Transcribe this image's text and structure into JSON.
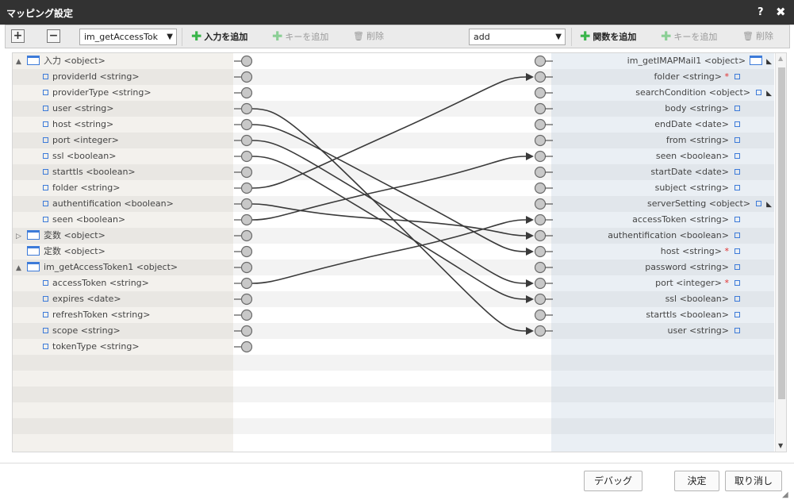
{
  "window": {
    "title": "マッピング設定",
    "help_label": "?",
    "close_label": "✖"
  },
  "toolbar": {
    "expand_label": "+",
    "collapse_label": "−",
    "source_select": "im_getAccessTok",
    "add_input_label": "入力を追加",
    "add_key_label_left": "キーを追加",
    "delete_label_left": "削除",
    "function_select": "add",
    "add_function_label": "関数を追加",
    "add_key_label_right": "キーを追加",
    "delete_label_right": "削除"
  },
  "left_tree": [
    {
      "label": "入力 <object>",
      "kind": "object",
      "indent": 0,
      "toggle": "▲"
    },
    {
      "label": "providerId <string>",
      "kind": "field",
      "indent": 1
    },
    {
      "label": "providerType <string>",
      "kind": "field",
      "indent": 1
    },
    {
      "label": "user <string>",
      "kind": "field",
      "indent": 1
    },
    {
      "label": "host <string>",
      "kind": "field",
      "indent": 1
    },
    {
      "label": "port <integer>",
      "kind": "field",
      "indent": 1
    },
    {
      "label": "ssl <boolean>",
      "kind": "field",
      "indent": 1
    },
    {
      "label": "starttls <boolean>",
      "kind": "field",
      "indent": 1
    },
    {
      "label": "folder <string>",
      "kind": "field",
      "indent": 1
    },
    {
      "label": "authentification <boolean>",
      "kind": "field",
      "indent": 1
    },
    {
      "label": "seen <boolean>",
      "kind": "field",
      "indent": 1
    },
    {
      "label": "変数 <object>",
      "kind": "object",
      "indent": 0,
      "toggle": "▷"
    },
    {
      "label": "定数 <object>",
      "kind": "object",
      "indent": 0,
      "toggle": ""
    },
    {
      "label": "im_getAccessToken1 <object>",
      "kind": "object",
      "indent": 0,
      "toggle": "▲"
    },
    {
      "label": "accessToken <string>",
      "kind": "field",
      "indent": 1
    },
    {
      "label": "expires <date>",
      "kind": "field",
      "indent": 1
    },
    {
      "label": "refreshToken <string>",
      "kind": "field",
      "indent": 1
    },
    {
      "label": "scope <string>",
      "kind": "field",
      "indent": 1
    },
    {
      "label": "tokenType <string>",
      "kind": "field",
      "indent": 1
    }
  ],
  "right_tree": [
    {
      "label": "im_getIMAPMail1 <object>",
      "kind": "object"
    },
    {
      "label": "folder <string>",
      "kind": "field",
      "required": "*"
    },
    {
      "label": "searchCondition <object>",
      "kind": "field",
      "sort": "◣"
    },
    {
      "label": "body <string>",
      "kind": "field"
    },
    {
      "label": "endDate <date>",
      "kind": "field"
    },
    {
      "label": "from <string>",
      "kind": "field"
    },
    {
      "label": "seen <boolean>",
      "kind": "field"
    },
    {
      "label": "startDate <date>",
      "kind": "field"
    },
    {
      "label": "subject <string>",
      "kind": "field"
    },
    {
      "label": "serverSetting <object>",
      "kind": "field",
      "sort": "◣"
    },
    {
      "label": "accessToken <string>",
      "kind": "field"
    },
    {
      "label": "authentification <boolean>",
      "kind": "field"
    },
    {
      "label": "host <string>",
      "kind": "field",
      "required": "*"
    },
    {
      "label": "password <string>",
      "kind": "field"
    },
    {
      "label": "port <integer>",
      "kind": "field",
      "required": "*"
    },
    {
      "label": "ssl <boolean>",
      "kind": "field"
    },
    {
      "label": "starttls <boolean>",
      "kind": "field"
    },
    {
      "label": "user <string>",
      "kind": "field"
    }
  ],
  "mappings": [
    {
      "from": 3,
      "to": 17
    },
    {
      "from": 4,
      "to": 12
    },
    {
      "from": 5,
      "to": 14
    },
    {
      "from": 6,
      "to": 15
    },
    {
      "from": 8,
      "to": 1
    },
    {
      "from": 9,
      "to": 11
    },
    {
      "from": 10,
      "to": 6
    },
    {
      "from": 14,
      "to": 10
    }
  ],
  "colors": {
    "connector_line": "#3a3a3a",
    "required_mark": "#e0302f",
    "accent_icon": "#3d7bd9",
    "add_icon": "#39b54a"
  },
  "footer": {
    "debug_label": "デバッグ",
    "ok_label": "決定",
    "cancel_label": "取り消し",
    "resize_icon": "resize-grip-icon"
  }
}
